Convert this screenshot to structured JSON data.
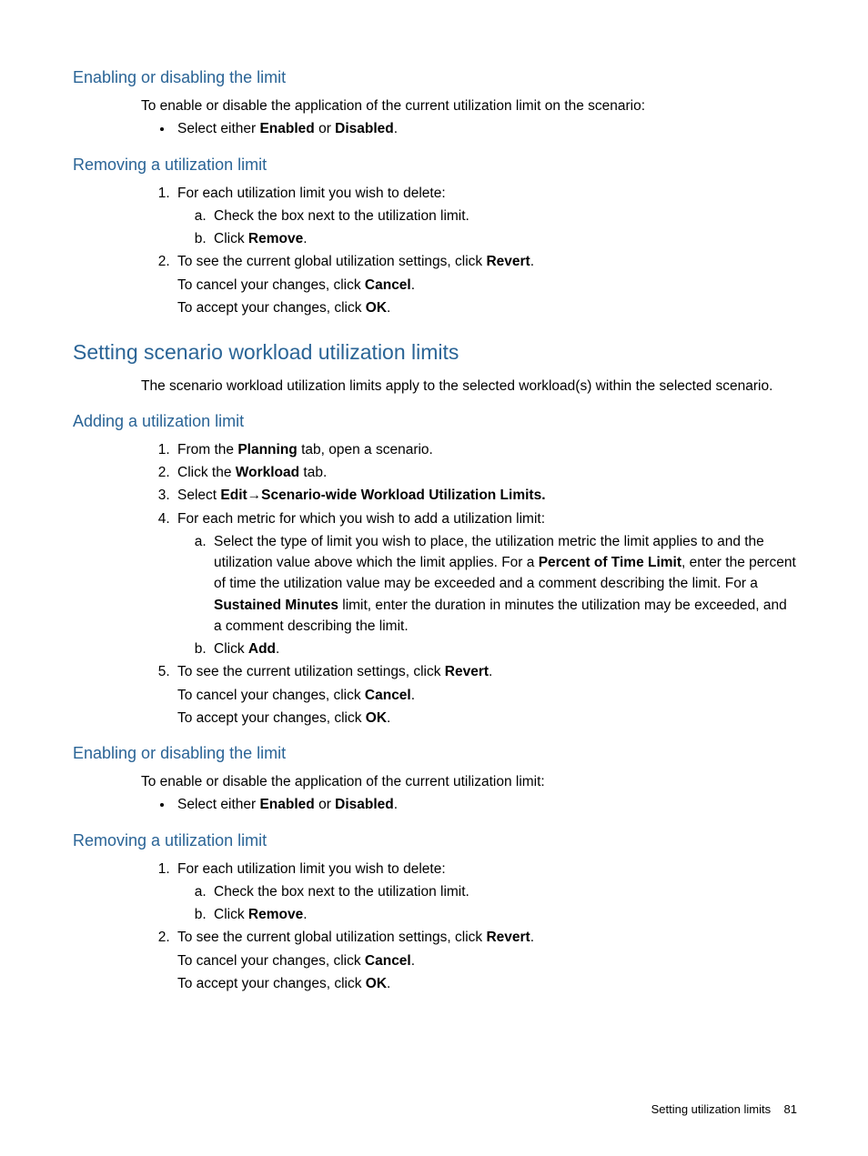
{
  "sec1": {
    "title": "Enabling or disabling the limit",
    "intro": "To enable or disable the application of the current utilization limit on the scenario:",
    "bullet_pre": "Select either ",
    "b1": "Enabled",
    "mid": " or ",
    "b2": "Disabled",
    "post": "."
  },
  "sec2": {
    "title": "Removing a utilization limit",
    "li1": "For each utilization limit you wish to delete:",
    "a": "Check the box next to the utilization limit.",
    "b_pre": "Click ",
    "b_bold": "Remove",
    "b_post": ".",
    "li2_pre": "To see the current global utilization settings, click ",
    "li2_bold": "Revert",
    "li2_post": ".",
    "cancel_pre": "To cancel your changes, click ",
    "cancel_bold": "Cancel",
    "cancel_post": ".",
    "ok_pre": "To accept your changes, click ",
    "ok_bold": "OK",
    "ok_post": "."
  },
  "sec3": {
    "title": "Setting scenario workload utilization limits",
    "intro": "The scenario workload utilization limits apply to the selected workload(s) within the selected scenario."
  },
  "sec4": {
    "title": "Adding a utilization limit",
    "li1_pre": "From the ",
    "li1_bold": "Planning",
    "li1_post": " tab, open a scenario.",
    "li2_pre": "Click the ",
    "li2_bold": "Workload",
    "li2_post": " tab.",
    "li3_pre": "Select ",
    "li3_b1": "Edit",
    "li3_arrow": "→",
    "li3_b2": "Scenario-wide Workload Utilization Limits.",
    "li4": "For each metric for which you wish to add a utilization limit:",
    "a_pre": "Select the type of limit you wish to place, the utilization metric the limit applies to and the utilization value above which the limit applies. For a ",
    "a_b1": "Percent of Time Limit",
    "a_mid": ", enter the percent of time the utilization value may be exceeded and a comment describing the limit. For a ",
    "a_b2": "Sustained Minutes",
    "a_post": " limit, enter the duration in minutes the utilization may be exceeded, and a comment describing the limit.",
    "b_pre": "Click ",
    "b_bold": "Add",
    "b_post": ".",
    "li5_pre": "To see the current utilization settings, click ",
    "li5_bold": "Revert",
    "li5_post": ".",
    "cancel_pre": "To cancel your changes, click ",
    "cancel_bold": "Cancel",
    "cancel_post": ".",
    "ok_pre": "To accept your changes, click ",
    "ok_bold": "OK",
    "ok_post": "."
  },
  "sec5": {
    "title": "Enabling or disabling the limit",
    "intro": "To enable or disable the application of the current utilization limit:",
    "bullet_pre": "Select either ",
    "b1": "Enabled",
    "mid": " or ",
    "b2": "Disabled",
    "post": "."
  },
  "sec6": {
    "title": "Removing a utilization limit",
    "li1": "For each utilization limit you wish to delete:",
    "a": "Check the box next to the utilization limit.",
    "b_pre": "Click ",
    "b_bold": "Remove",
    "b_post": ".",
    "li2_pre": "To see the current global utilization settings, click ",
    "li2_bold": "Revert",
    "li2_post": ".",
    "cancel_pre": "To cancel your changes, click ",
    "cancel_bold": "Cancel",
    "cancel_post": ".",
    "ok_pre": "To accept your changes, click ",
    "ok_bold": "OK",
    "ok_post": "."
  },
  "footer": {
    "text": "Setting utilization limits",
    "page": "81"
  }
}
